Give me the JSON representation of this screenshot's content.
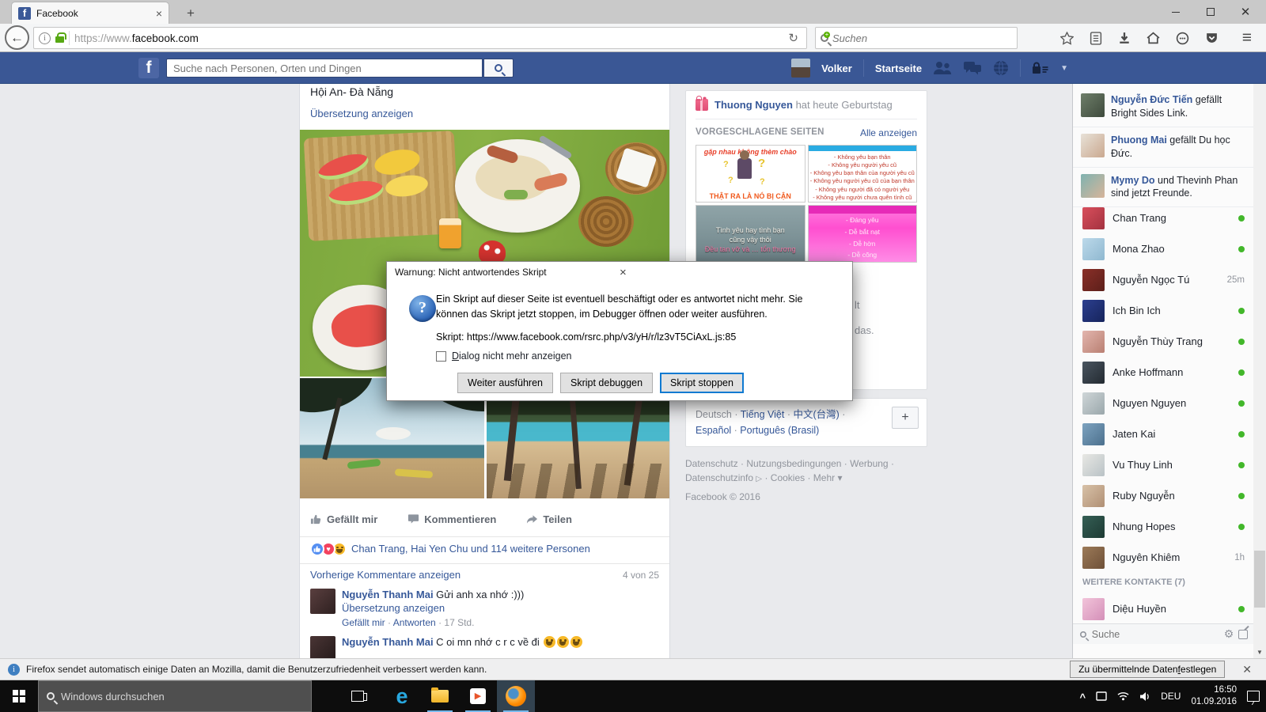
{
  "browser": {
    "tab_title": "Facebook",
    "url_prefix": "https://www.",
    "url_host": "facebook.com",
    "search_placeholder": "Suchen"
  },
  "fb": {
    "nav": {
      "search_placeholder": "Suche nach Personen, Orten und Dingen",
      "user": "Volker",
      "home": "Startseite"
    },
    "post": {
      "title": "Hội An- Đà Nẵng",
      "translate": "Übersetzung anzeigen",
      "like": "Gefällt mir",
      "comment": "Kommentieren",
      "share": "Teilen",
      "reactions": "Chan Trang, Hai Yen Chu und 114 weitere Personen",
      "prev": "Vorherige Kommentare anzeigen",
      "count": "4 von 25",
      "c1": {
        "name": "Nguyễn Thanh Mai",
        "text": " Gửi anh xa nhớ :)))",
        "translate": "Übersetzung anzeigen",
        "meta_like": "Gefällt mir",
        "meta_reply": "Antworten",
        "meta_time": "17 Std.",
        "colors": [
          "#5a3f3f",
          "#2e2020"
        ]
      },
      "c2": {
        "name": "Nguyễn Thanh Mai",
        "text": " C oi mn nhớ c r c về đi ",
        "emoji_icons": [
          "laughing-emoji",
          "laughing-emoji",
          "laughing-emoji"
        ],
        "colors": [
          "#4a3535",
          "#241a1a"
        ]
      }
    },
    "right": {
      "birthday_name": "Thuong Nguyen",
      "birthday_rest": "hat heute Geburtstag",
      "sug_header": "VORGESCHLAGENE SEITEN",
      "see_all": "Alle anzeigen",
      "card1_top": "gặp nhau không thèm chào",
      "card1_bottom": "THẬT RA LÀ NÓ BỊ CẬN",
      "card2_lines": [
        "- Không yêu bạn thân",
        "- Không yêu người yêu cũ",
        "- Không yêu bạn thân của người yêu cũ",
        "- Không yêu người yêu cũ của bạn thân",
        "- Không yêu người đã có người yêu",
        "- Không yêu người chưa quên tình cũ"
      ],
      "card3_l1": "Tình yêu hay tình bạn",
      "card3_l2": "cũng vậy thôi",
      "card3_l3": "Đều tan vỡ và … tổn thương",
      "card4_lines": [
        "- Đáng yêu",
        "- Dễ bắt nạt",
        "- Dễ hờn",
        "- Dễ cõng"
      ],
      "frag1": "lt",
      "frag2": "das.",
      "languages": [
        {
          "label": "Deutsch",
          "current": true
        },
        {
          "label": "Tiếng Việt",
          "current": false
        },
        {
          "label": "中文(台灣)",
          "current": false
        },
        {
          "label": "Español",
          "current": false
        },
        {
          "label": "Português (Brasil)",
          "current": false
        }
      ],
      "plus": "+",
      "footer_l1": "Datenschutz · Nutzungsbedingungen · Werbung ·",
      "footer_l2a": "Datenschutzinfo",
      "footer_l2b": "· Cookies · Mehr ▾",
      "copyright": "Facebook © 2016"
    },
    "ticker": [
      {
        "name": "Nguyễn Đức Tiến",
        "rest": " gefällt Bright Sides Link.",
        "colors": [
          "#6f7f6a",
          "#3e4a3c"
        ]
      },
      {
        "name": "Phuong Mai",
        "rest": " gefällt Du học Đức.",
        "colors": [
          "#e8e2d8",
          "#caa88f"
        ]
      },
      {
        "name": "Mymy Do",
        "rest": " und Thevinh Phan sind jetzt Freunde.",
        "colors": [
          "#7fb3b0",
          "#d7b49a"
        ]
      }
    ],
    "chat": {
      "contacts": [
        {
          "name": "Chan Trang",
          "status": "online",
          "colors": [
            "#d94f5c",
            "#a33240"
          ]
        },
        {
          "name": "Mona Zhao",
          "status": "online",
          "colors": [
            "#bcd9ea",
            "#8fb8d0"
          ]
        },
        {
          "name": "Nguyễn Ngọc Tú",
          "status": "25m",
          "colors": [
            "#8a2f28",
            "#5c1f1a"
          ]
        },
        {
          "name": "Ich Bin Ich",
          "status": "online",
          "colors": [
            "#2c3f8f",
            "#16245c"
          ]
        },
        {
          "name": "Nguyễn Thùy Trang",
          "status": "online",
          "colors": [
            "#e3b6ae",
            "#b97f72"
          ]
        },
        {
          "name": "Anke Hoffmann",
          "status": "online",
          "colors": [
            "#4a5560",
            "#232a31"
          ]
        },
        {
          "name": "Nguyen Nguyen",
          "status": "online",
          "colors": [
            "#cfd6d8",
            "#9aa7ab"
          ]
        },
        {
          "name": "Jaten Kai",
          "status": "online",
          "colors": [
            "#7da3c0",
            "#4c708d"
          ]
        },
        {
          "name": "Vu Thuy Linh",
          "status": "online",
          "colors": [
            "#e8e8e4",
            "#b9c2c6"
          ]
        },
        {
          "name": "Ruby Nguyễn",
          "status": "online",
          "colors": [
            "#d8c2a8",
            "#b08f74"
          ]
        },
        {
          "name": "Nhung Hopes",
          "status": "online",
          "colors": [
            "#355f55",
            "#1d3a33"
          ]
        },
        {
          "name": "Nguyên Khiêm",
          "status": "1h",
          "colors": [
            "#9c7a58",
            "#6e5038"
          ]
        }
      ],
      "more_header": "WEITERE KONTAKTE (7)",
      "more_contacts": [
        {
          "name": "Diệu Huyền",
          "status": "online",
          "colors": [
            "#f2c4da",
            "#d48fb8"
          ]
        }
      ],
      "search_placeholder": "Suche"
    }
  },
  "dialog": {
    "title": "Warnung: Nicht antwortendes Skript",
    "body": "Ein Skript auf dieser Seite ist eventuell beschäftigt oder es antwortet nicht mehr. Sie können das Skript jetzt stoppen, im Debugger öffnen oder weiter ausführen.",
    "script_line": "Skript: https://www.facebook.com/rsrc.php/v3/yH/r/lz3vT5CiAxL.js:85",
    "checkbox_key": "D",
    "checkbox_rest": "ialog nicht mehr anzeigen",
    "btn_continue": "Weiter ausführen",
    "btn_debug": "Skript debuggen",
    "btn_stop": "Skript stoppen"
  },
  "infobar": {
    "text": "Firefox sendet automatisch einige Daten an Mozilla, damit die Benutzerzufriedenheit verbessert werden kann.",
    "btn_pre": "Zu übermittelnde Daten ",
    "btn_key": "f",
    "btn_rest": "estlegen"
  },
  "taskbar": {
    "search": "Windows durchsuchen",
    "lang": "DEU",
    "time": "16:50",
    "date": "01.09.2016"
  },
  "colors": {
    "fb_blue": "#3a5795",
    "link_blue": "#365899",
    "online_green": "#42b72a",
    "focus_blue": "#0f7ad1"
  }
}
